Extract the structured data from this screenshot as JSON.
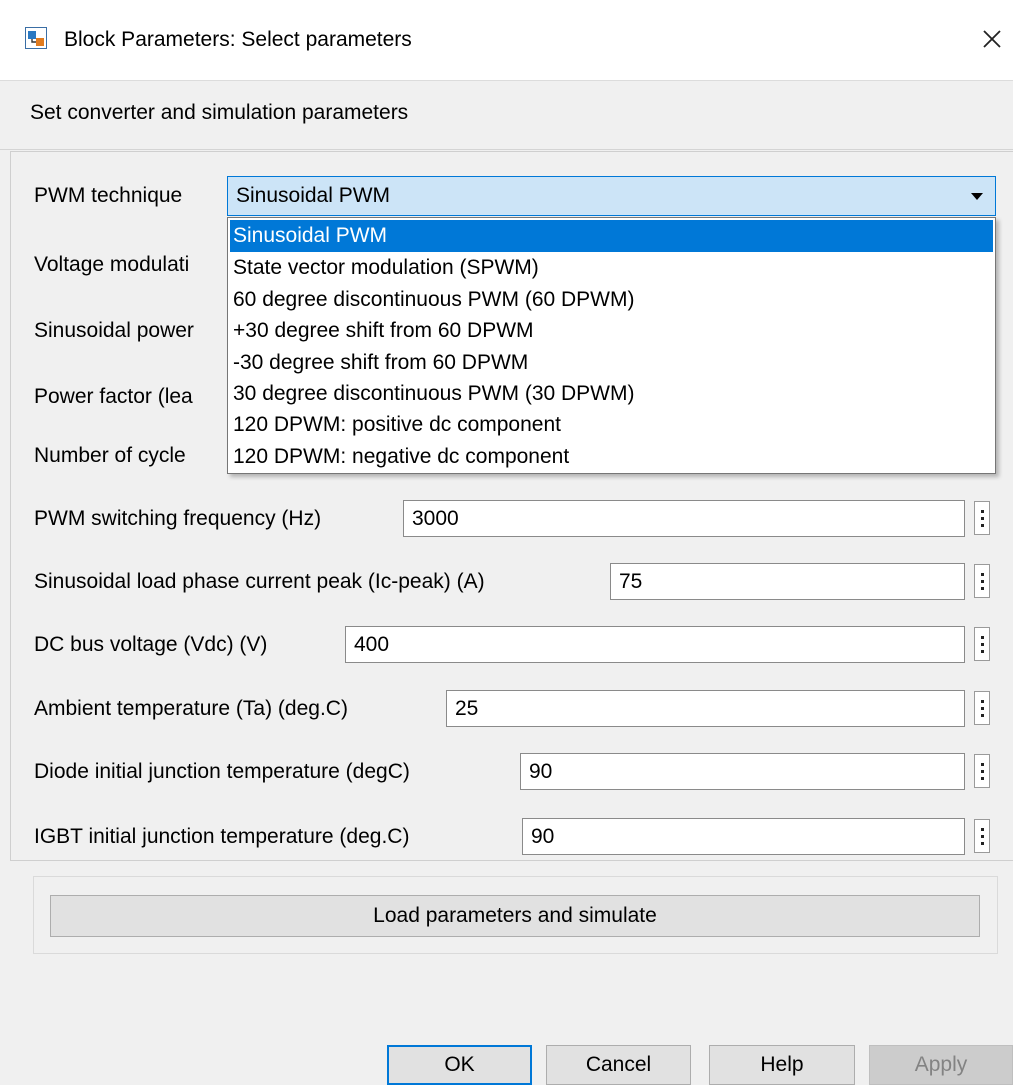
{
  "window": {
    "title": "Block Parameters: Select parameters"
  },
  "description": "Set  converter and simulation parameters",
  "pwm": {
    "label": "PWM technique",
    "selected": "Sinusoidal PWM",
    "options": [
      "Sinusoidal PWM",
      "State vector modulation (SPWM)",
      "60 degree discontinuous PWM (60 DPWM)",
      "+30 degree shift from 60 DPWM",
      "-30 degree shift from 60 DPWM",
      "30 degree discontinuous PWM (30 DPWM)",
      "120 DPWM: positive dc component",
      "120 DPWM: negative dc component"
    ]
  },
  "hidden_labels": [
    "Voltage modulati",
    "Sinusoidal power",
    "Power factor (lea",
    "Number of cycle"
  ],
  "fields": [
    {
      "label": "PWM switching frequency (Hz)",
      "value": "3000"
    },
    {
      "label": "Sinusoidal load phase current peak (Ic-peak) (A)",
      "value": "75"
    },
    {
      "label": "DC bus voltage (Vdc)  (V)",
      "value": "400"
    },
    {
      "label": "Ambient temperature (Ta) (deg.C)",
      "value": "25"
    },
    {
      "label": "Diode initial junction temperature (degC)",
      "value": "90"
    },
    {
      "label": "IGBT initial junction temperature (deg.C)",
      "value": "90"
    }
  ],
  "simulate_button": "Load parameters and simulate",
  "buttons": {
    "ok": "OK",
    "cancel": "Cancel",
    "help": "Help",
    "apply": "Apply"
  },
  "colors": {
    "accent": "#0078d7",
    "selection_bg": "#cce4f7"
  },
  "icons": {
    "app": "simulink-block-icon",
    "close": "close-icon",
    "dropdown": "chevron-down-icon",
    "more": "kebab-menu-icon"
  }
}
